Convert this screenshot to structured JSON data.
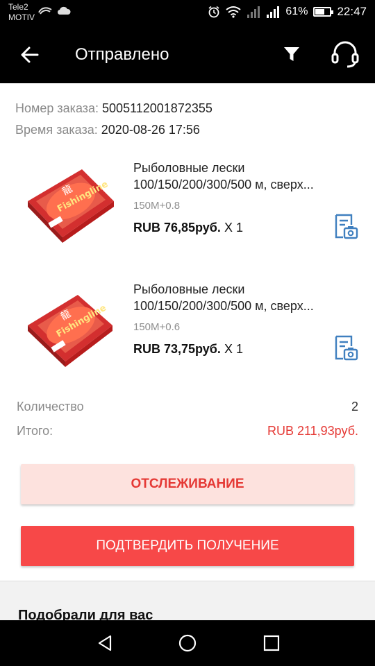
{
  "status_bar": {
    "carrier_line1": "Tele2",
    "carrier_line2": "MOTIV",
    "battery_percent": "61%",
    "battery_level": 0.61,
    "time": "22:47"
  },
  "header": {
    "title": "Отправлено",
    "icons": [
      "back-arrow-icon",
      "filter-icon",
      "headset-icon"
    ]
  },
  "order": {
    "number_label": "Номер заказа:",
    "number_value": "5005112001872355",
    "time_label": "Время заказа:",
    "time_value": "2020-08-26 17:56"
  },
  "items": [
    {
      "title_line1": "Рыболовные лески",
      "title_line2": "100/150/200/300/500 м, сверх...",
      "variant": "150M+0.8",
      "price": "RUB 76,85руб.",
      "qty": "X 1"
    },
    {
      "title_line1": "Рыболовные лески",
      "title_line2": "100/150/200/300/500 м, сверх...",
      "variant": "150M+0.6",
      "price": "RUB 73,75руб.",
      "qty": "X 1"
    }
  ],
  "summary": {
    "quantity_label": "Количество",
    "quantity_value": "2",
    "total_label": "Итого:",
    "total_value": "RUB 211,93руб."
  },
  "buttons": {
    "track": "ОТСЛЕЖИВАНИЕ",
    "confirm": "ПОДТВЕРДИТЬ ПОЛУЧЕНИЕ"
  },
  "recommendations": {
    "title": "Подобрали для вас"
  },
  "colors": {
    "accent_red": "#e53935",
    "confirm_button": "#f74848",
    "track_button_bg": "#fde2de",
    "icon_blue": "#3f7fbf"
  }
}
